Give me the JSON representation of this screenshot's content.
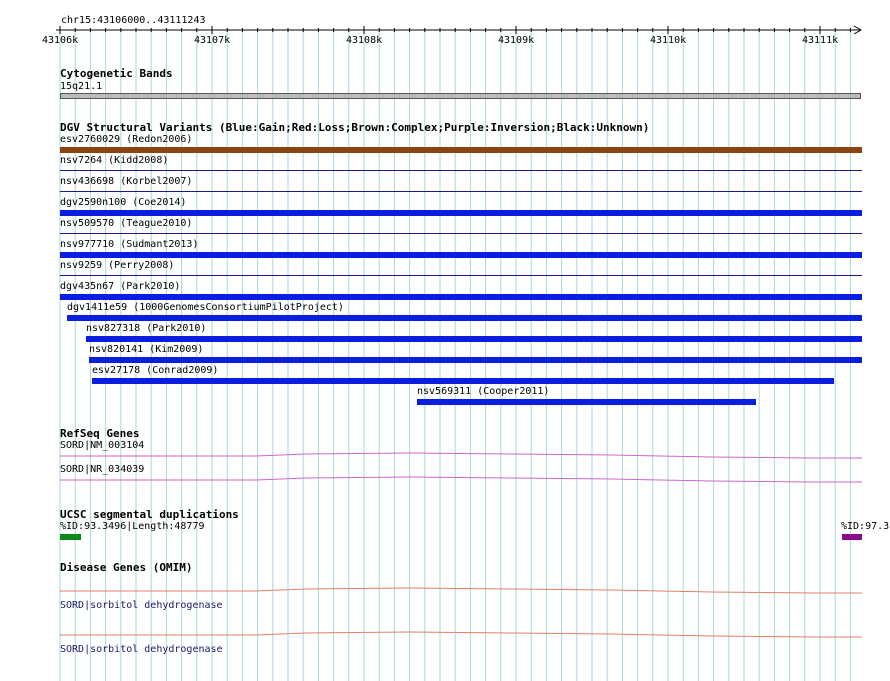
{
  "colors": {
    "grid": "#a9d6e6",
    "gain": "#0a1ee0",
    "loss": "#d01010",
    "complex": "#8b4513",
    "line": "#1a1a8a",
    "gene": "#cc66cc",
    "omim": "#e08060",
    "seg_green": "#0a8a1a",
    "seg_purple": "#8a0a8a",
    "band": "#bcbcbc"
  },
  "ruler": {
    "location": "chr15:43106000..43111243",
    "ticks": [
      "43106k",
      "43107k",
      "43108k",
      "43109k",
      "43110k",
      "43111k"
    ]
  },
  "tracks": {
    "cytoband": {
      "title": "Cytogenetic Bands",
      "band_label": "15q21.1"
    },
    "dgv": {
      "title": "DGV Structural Variants (Blue:Gain;Red:Loss;Brown:Complex;Purple:Inversion;Black:Unknown)",
      "variants": [
        {
          "label": "esv2760029 (Redon2006)",
          "type": "complex"
        },
        {
          "label": "nsv7264 (Kidd2008)",
          "type": "line"
        },
        {
          "label": "nsv436698 (Korbel2007)",
          "type": "line"
        },
        {
          "label": "dgv2590n100 (Coe2014)",
          "type": "gain"
        },
        {
          "label": "nsv509570 (Teague2010)",
          "type": "line"
        },
        {
          "label": "nsv977710 (Sudmant2013)",
          "type": "gain"
        },
        {
          "label": "nsv9259 (Perry2008)",
          "type": "line"
        },
        {
          "label": "dgv435n67 (Park2010)",
          "type": "gain"
        },
        {
          "label": "dgv1411e59 (1000GenomesConsortiumPilotProject)",
          "type": "gain"
        },
        {
          "label": "nsv827318 (Park2010)",
          "type": "gain"
        },
        {
          "label": "nsv820141 (Kim2009)",
          "type": "gain"
        },
        {
          "label": "esv27178 (Conrad2009)",
          "type": "gain"
        },
        {
          "label": "nsv569311 (Cooper2011)",
          "type": "gain"
        }
      ]
    },
    "refseq": {
      "title": "RefSeq Genes",
      "genes": [
        {
          "label": "SORD|NM_003104"
        },
        {
          "label": "SORD|NR_034039"
        }
      ]
    },
    "segdup": {
      "title": "UCSC segmental duplications",
      "left_label": "%ID:93.3496|Length:48779",
      "right_label": "%ID:97.3"
    },
    "omim": {
      "title": "Disease Genes (OMIM)",
      "genes": [
        {
          "label": "SORD|sorbitol dehydrogenase"
        },
        {
          "label": "SORD|sorbitol dehydrogenase"
        }
      ]
    }
  }
}
